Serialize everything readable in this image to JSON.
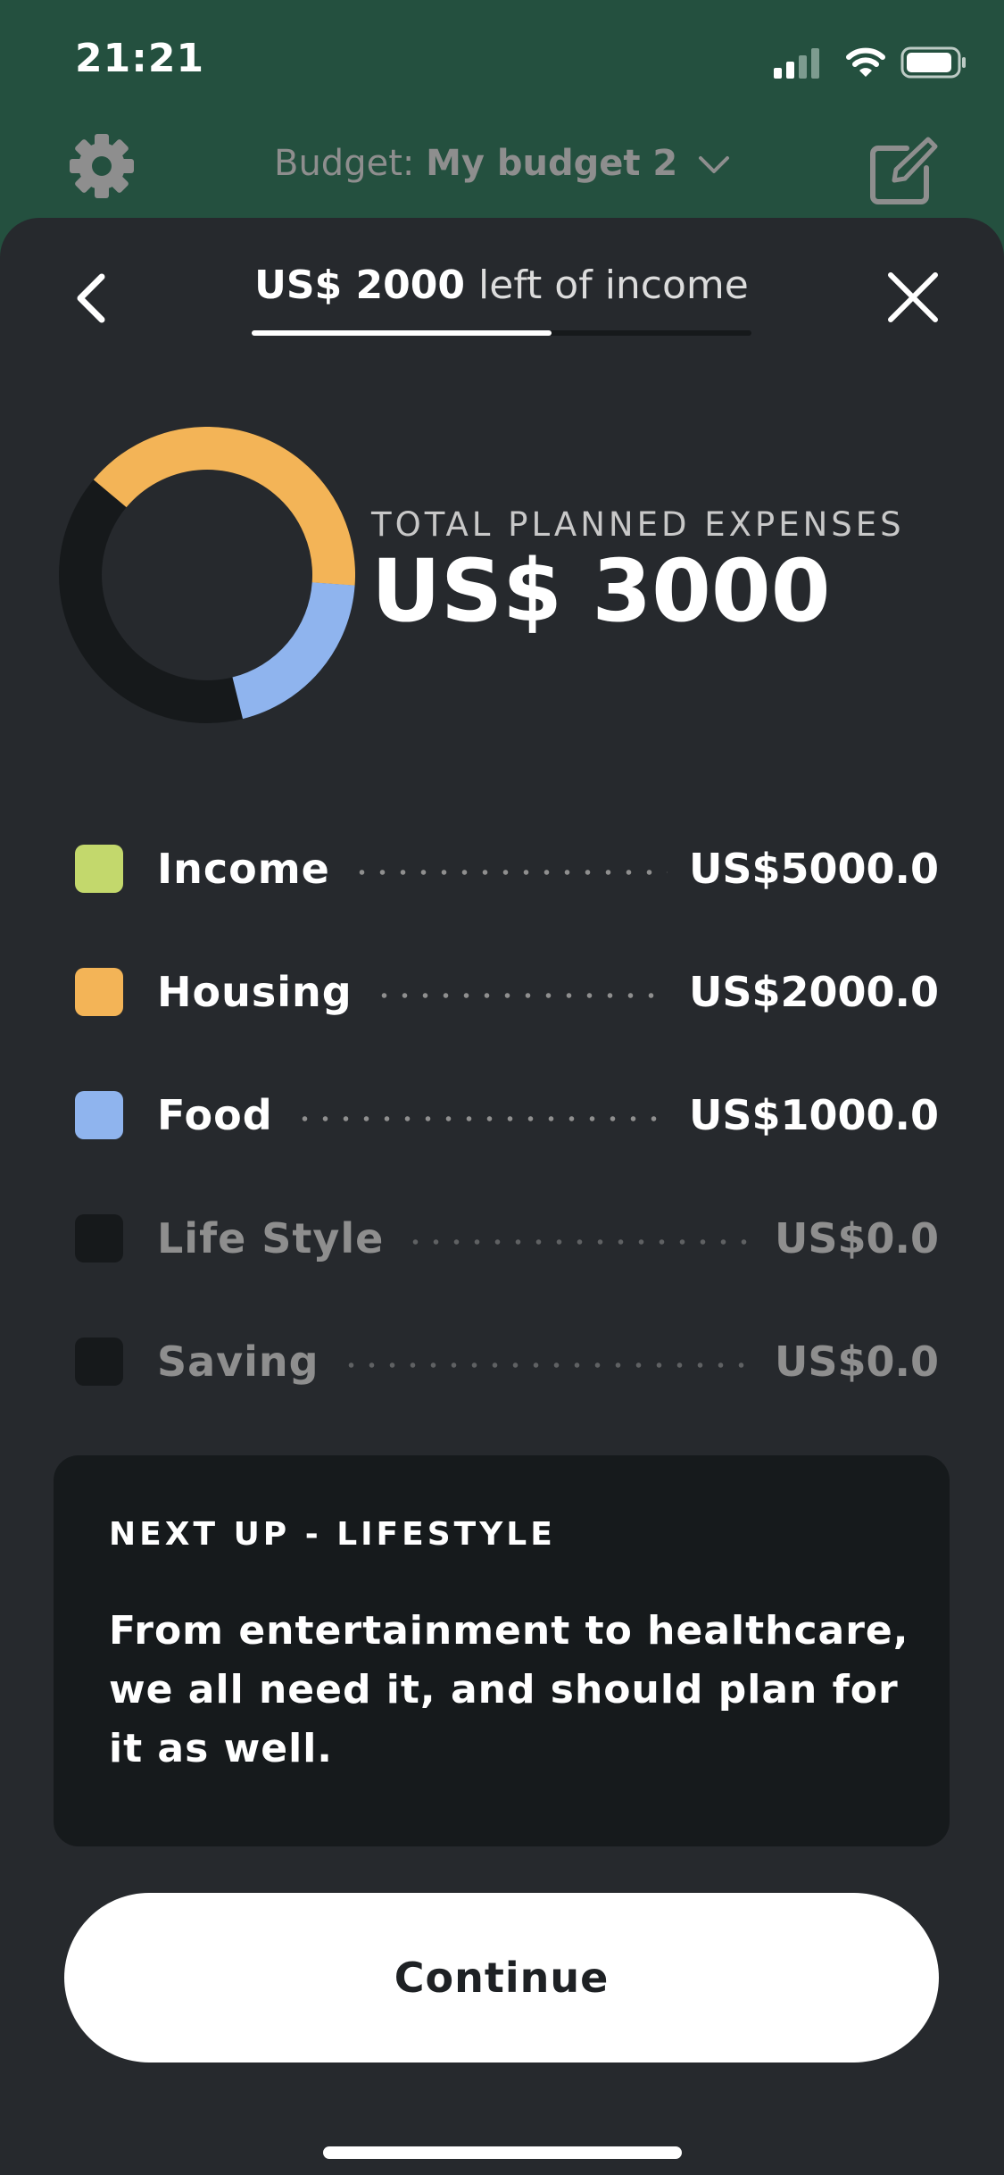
{
  "status_bar": {
    "time": "21:21",
    "icons": [
      "cellular-signal-icon",
      "wifi-icon",
      "battery-icon"
    ]
  },
  "header": {
    "budget_prefix": "Budget:",
    "budget_name": "My budget 2",
    "icons": [
      "gear-icon",
      "chevron-down-icon",
      "edit-icon"
    ]
  },
  "sheet": {
    "remaining_amount": "US$ 2000",
    "remaining_caption": "left of income",
    "remaining_progress": 0.6,
    "icons": [
      "chevron-left-icon",
      "close-icon"
    ]
  },
  "summary": {
    "label": "TOTAL PLANNED EXPENSES",
    "value": "US$ 3000"
  },
  "categories": [
    {
      "name": "Income",
      "amount": "US$5000.0",
      "color": "#c3d86c",
      "active": true
    },
    {
      "name": "Housing",
      "amount": "US$2000.0",
      "color": "#f3b457",
      "active": true
    },
    {
      "name": "Food",
      "amount": "US$1000.0",
      "color": "#8fb4ee",
      "active": true
    },
    {
      "name": "Life Style",
      "amount": "US$0.0",
      "color": "#16191b",
      "active": false
    },
    {
      "name": "Saving",
      "amount": "US$0.0",
      "color": "#16191b",
      "active": false
    }
  ],
  "chart_data": {
    "type": "pie",
    "donut": true,
    "total": 5000,
    "categories": [
      "Housing",
      "Food"
    ],
    "values": [
      2000,
      1000
    ],
    "colors": [
      "#f3b457",
      "#8fb4ee"
    ],
    "remainder_color": "#16191b"
  },
  "next_up": {
    "title": "NEXT UP - LIFESTYLE",
    "body": "From entertainment to healthcare, we all need it, and should plan for it as well."
  },
  "continue_label": "Continue"
}
